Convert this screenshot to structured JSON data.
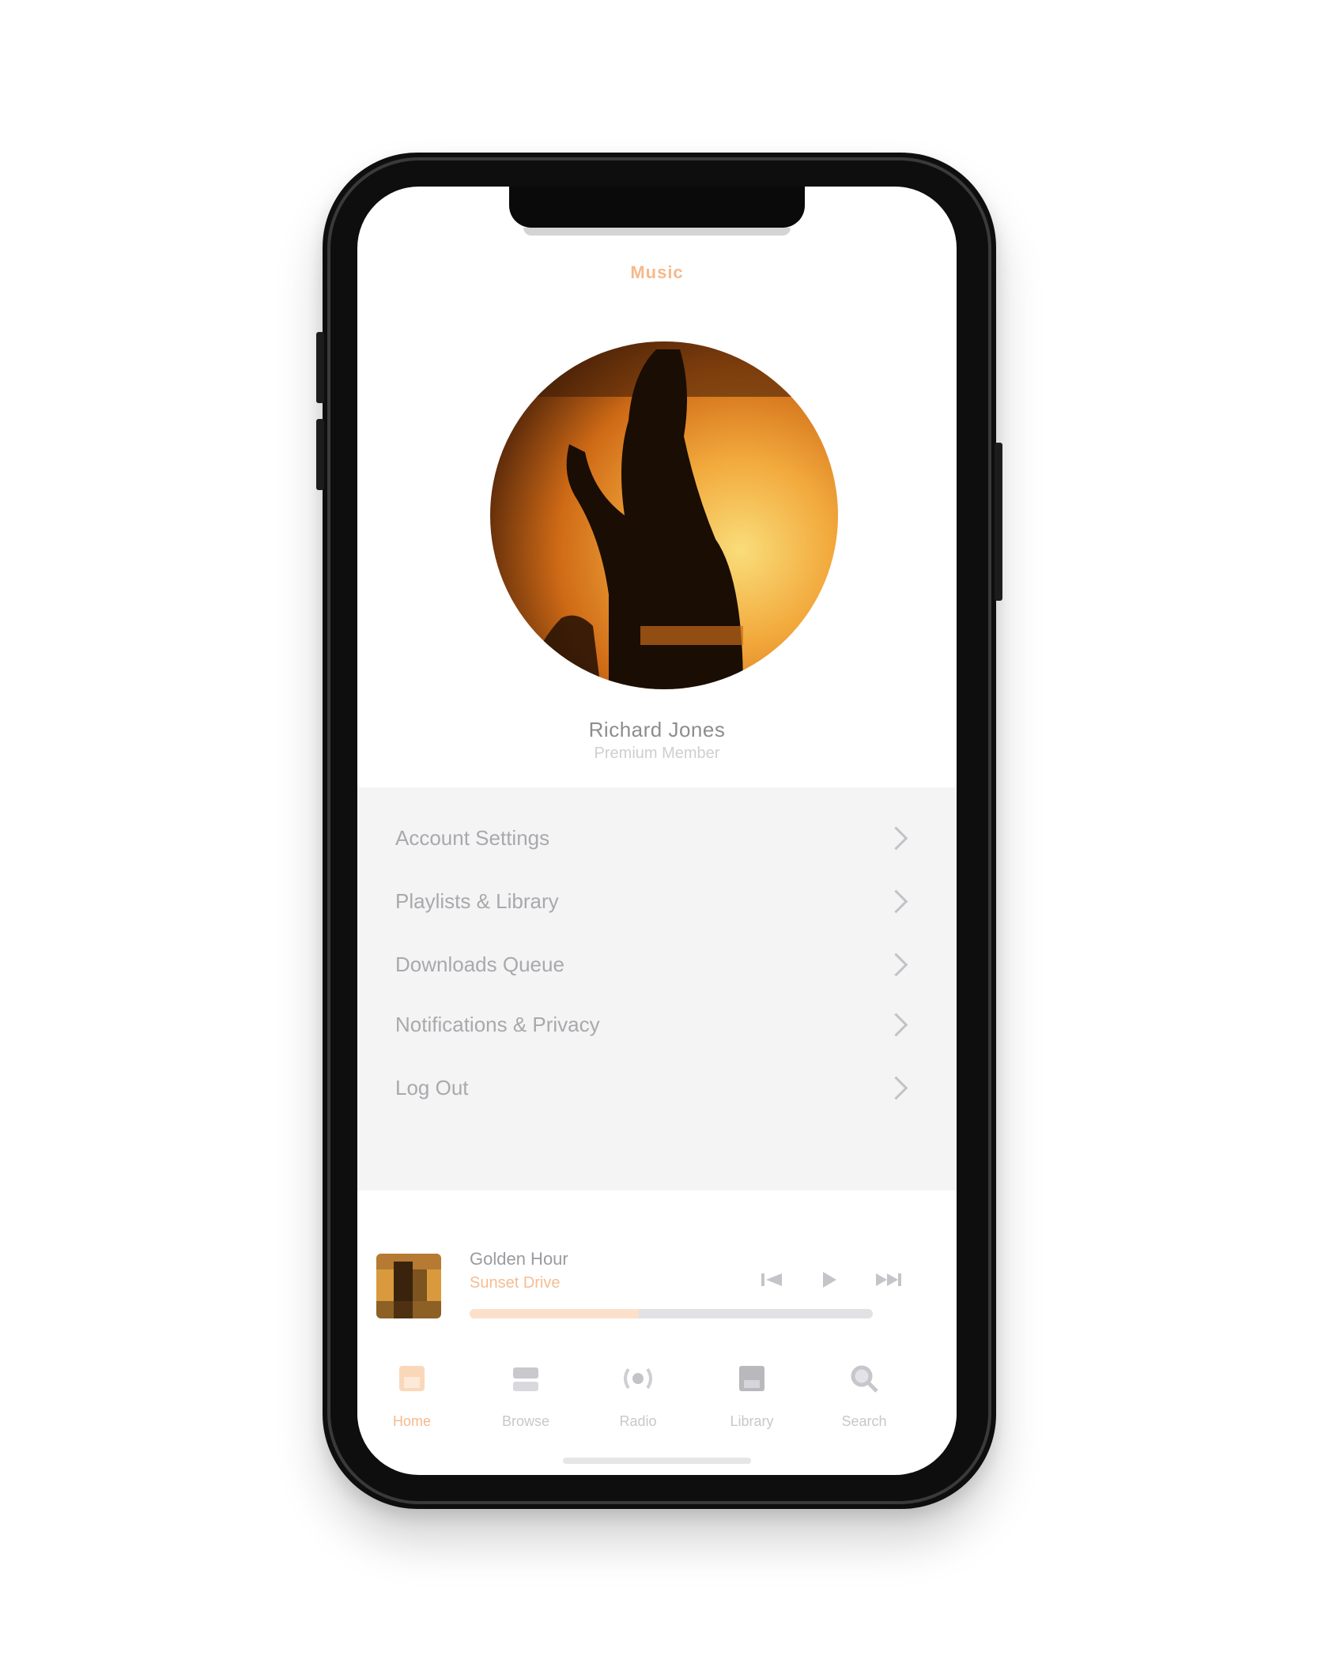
{
  "app": {
    "brand": "Music",
    "accent_color": "#f6b98a"
  },
  "profile": {
    "name": "Richard Jones",
    "subtitle": "Premium Member",
    "avatar_icon": "sunset-silhouette-image"
  },
  "menu": {
    "items": [
      {
        "label": "Account Settings",
        "icon": "chevron-right-icon"
      },
      {
        "label": "Playlists & Library",
        "icon": "chevron-right-icon"
      },
      {
        "label": "Downloads Queue",
        "icon": "chevron-right-icon"
      },
      {
        "label": "Notifications & Privacy",
        "icon": "chevron-right-icon"
      },
      {
        "label": "Log Out",
        "icon": "chevron-right-icon"
      }
    ]
  },
  "now_playing": {
    "title": "Golden Hour",
    "artist": "Sunset Drive",
    "progress": 0.42,
    "controls": [
      "previous-icon",
      "play-icon",
      "next-icon"
    ]
  },
  "tabbar": {
    "tabs": [
      {
        "label": "Home",
        "icon": "home-icon",
        "active": true
      },
      {
        "label": "Browse",
        "icon": "browse-icon",
        "active": false
      },
      {
        "label": "Radio",
        "icon": "radio-icon",
        "active": false
      },
      {
        "label": "Library",
        "icon": "library-icon",
        "active": false
      },
      {
        "label": "Search",
        "icon": "search-icon",
        "active": false
      }
    ]
  }
}
